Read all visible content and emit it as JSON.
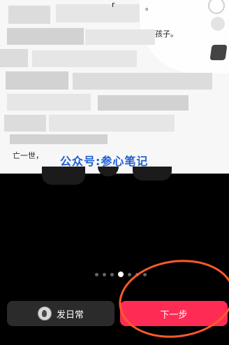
{
  "preview": {
    "fragment_top": "r",
    "fragment_top_end": "。",
    "fragment_mid": "孩子。",
    "fragment_bottom": "亡一世，",
    "watermark": "公众号:参心笔记"
  },
  "pager": {
    "count": 7,
    "active_index": 3
  },
  "actions": {
    "daily_label": "发日常",
    "next_label": "下一步"
  },
  "colors": {
    "accent": "#fe2c55",
    "annotation": "#ff5a2a",
    "watermark": "#1f5fd6"
  }
}
